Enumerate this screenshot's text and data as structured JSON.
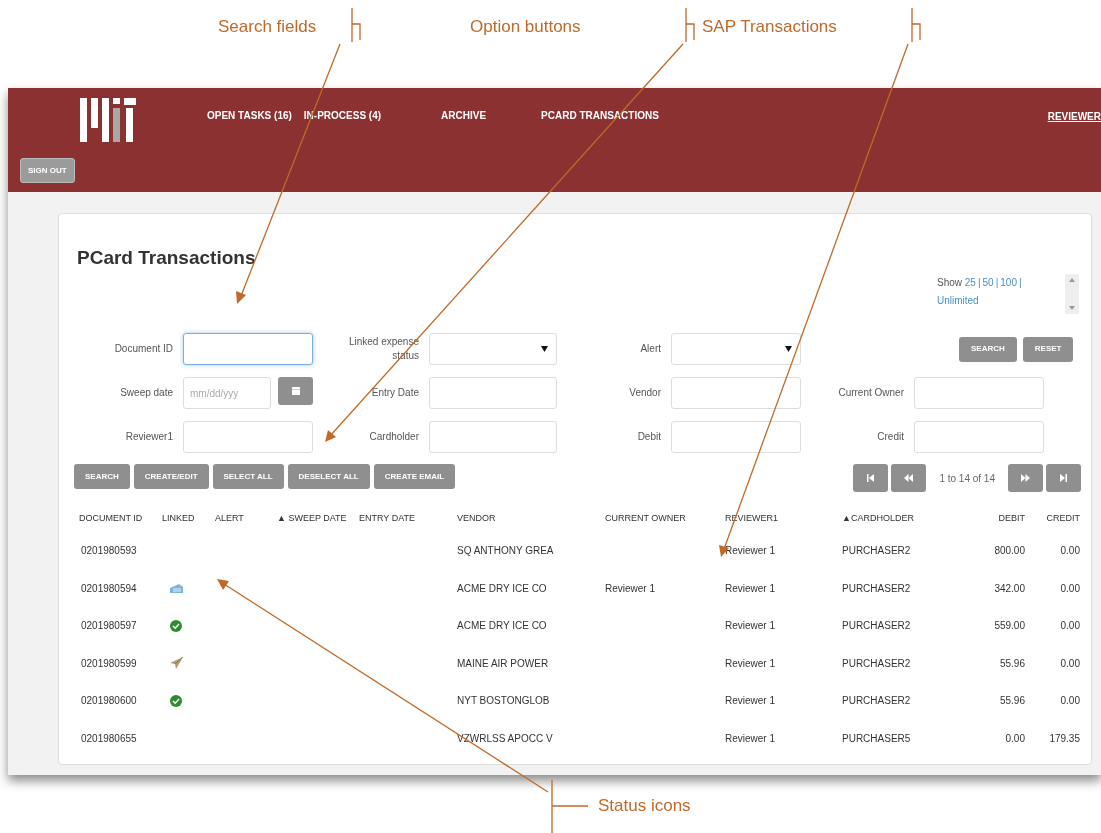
{
  "callouts": [
    {
      "label": "Search fields"
    },
    {
      "label": "Option buttons"
    },
    {
      "label": "SAP Transactions"
    },
    {
      "label": "Status icons"
    }
  ],
  "header": {
    "nav": [
      {
        "label": "OPEN TASKS (16)",
        "selected": false
      },
      {
        "label": "IN-PROCESS (4)",
        "selected": false
      },
      {
        "label": "ARCHIVE",
        "selected": false
      },
      {
        "label": "PCARD TRANSACTIONS",
        "selected": false
      }
    ],
    "user_link": "REVIEWER",
    "sign_out": "SIGN OUT"
  },
  "page_title": "PCard Transactions",
  "show": {
    "label": "Show",
    "separator": "|",
    "options": [
      "25",
      "50",
      "100",
      "Unlimited"
    ]
  },
  "top_buttons": [
    "SEARCH",
    "RESET"
  ],
  "filters": [
    [
      {
        "label": "Document ID",
        "kind": "text",
        "focused": true
      },
      {
        "label": "Linked expense status",
        "kind": "select"
      },
      {
        "label": "Alert",
        "kind": "select"
      }
    ],
    [
      {
        "label": "Sweep date",
        "kind": "date",
        "placeholder": "mm/dd/yyy"
      },
      {
        "label": "Entry Date",
        "kind": "text"
      },
      {
        "label": "Vendor",
        "kind": "text"
      },
      {
        "label": "Current Owner",
        "kind": "text"
      }
    ],
    [
      {
        "label": "Reviewer1",
        "kind": "text"
      },
      {
        "label": "Cardholder",
        "kind": "text"
      },
      {
        "label": "Debit",
        "kind": "text"
      },
      {
        "label": "Credit",
        "kind": "text"
      }
    ]
  ],
  "action_buttons": [
    "SEARCH",
    "CREATE/EDIT",
    "SELECT ALL",
    "DESELECT ALL",
    "CREATE EMAIL"
  ],
  "pager": {
    "range": "1 to 14 of 14"
  },
  "table": {
    "columns": [
      "DOCUMENT ID",
      "LINKED",
      "ALERT",
      "▲ SWEEP DATE",
      "ENTRY DATE",
      "VENDOR",
      "CURRENT OWNER",
      "REVIEWER1",
      "▲CARDHOLDER",
      "DEBIT",
      "CREDIT"
    ],
    "rows": [
      {
        "document_id": "0201980593",
        "vendor": "SQ ANTHONY GREA",
        "reviewer1": "Reviewer 1",
        "cardholder": "PURCHASER2",
        "debit": "800.00",
        "credit": "0.00"
      },
      {
        "document_id": "0201980594",
        "linked": {
          "kind": "document"
        },
        "vendor": "ACME DRY ICE CO",
        "current_owner": "Reviewer 1",
        "reviewer1": "Reviewer 1",
        "cardholder": "PURCHASER2",
        "debit": "342.00",
        "credit": "0.00"
      },
      {
        "document_id": "0201980597",
        "linked": {
          "kind": "approved"
        },
        "vendor": "ACME DRY ICE CO",
        "reviewer1": "Reviewer 1",
        "cardholder": "PURCHASER2",
        "debit": "559.00",
        "credit": "0.00"
      },
      {
        "document_id": "0201980599",
        "linked": {
          "kind": "sent"
        },
        "vendor": "MAINE AIR POWER",
        "reviewer1": "Reviewer 1",
        "cardholder": "PURCHASER2",
        "debit": "55.96",
        "credit": "0.00"
      },
      {
        "document_id": "0201980600",
        "linked": {
          "kind": "approved"
        },
        "vendor": "NYT BOSTONGLOB",
        "reviewer1": "Reviewer 1",
        "cardholder": "PURCHASER2",
        "debit": "55.96",
        "credit": "0.00"
      },
      {
        "document_id": "0201980655",
        "vendor": "VZWRLSS APOCC V",
        "reviewer1": "Reviewer 1",
        "cardholder": "PURCHASER5",
        "debit": "0.00",
        "credit": "179.35"
      }
    ]
  }
}
